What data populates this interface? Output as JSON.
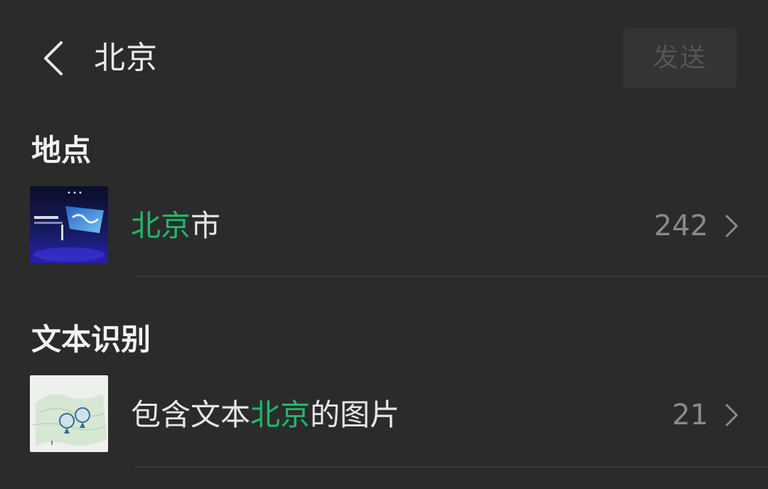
{
  "header": {
    "title": "北京",
    "send_label": "发送"
  },
  "sections": [
    {
      "heading": "地点",
      "items": [
        {
          "label_parts": [
            {
              "text": "北京",
              "highlight": true
            },
            {
              "text": "市",
              "highlight": false
            }
          ],
          "count": "242"
        }
      ]
    },
    {
      "heading": "文本识别",
      "items": [
        {
          "label_parts": [
            {
              "text": "包含文本",
              "highlight": false
            },
            {
              "text": "北京",
              "highlight": true
            },
            {
              "text": "的图片",
              "highlight": false
            }
          ],
          "count": "21"
        }
      ]
    }
  ],
  "colors": {
    "background": "#2b2b2b",
    "highlight": "#1fb86a",
    "count_text": "#8a8a8a",
    "send_button_bg": "#343434"
  },
  "icons": {
    "back": "chevron-left-icon",
    "row_arrow": "chevron-right-icon"
  }
}
